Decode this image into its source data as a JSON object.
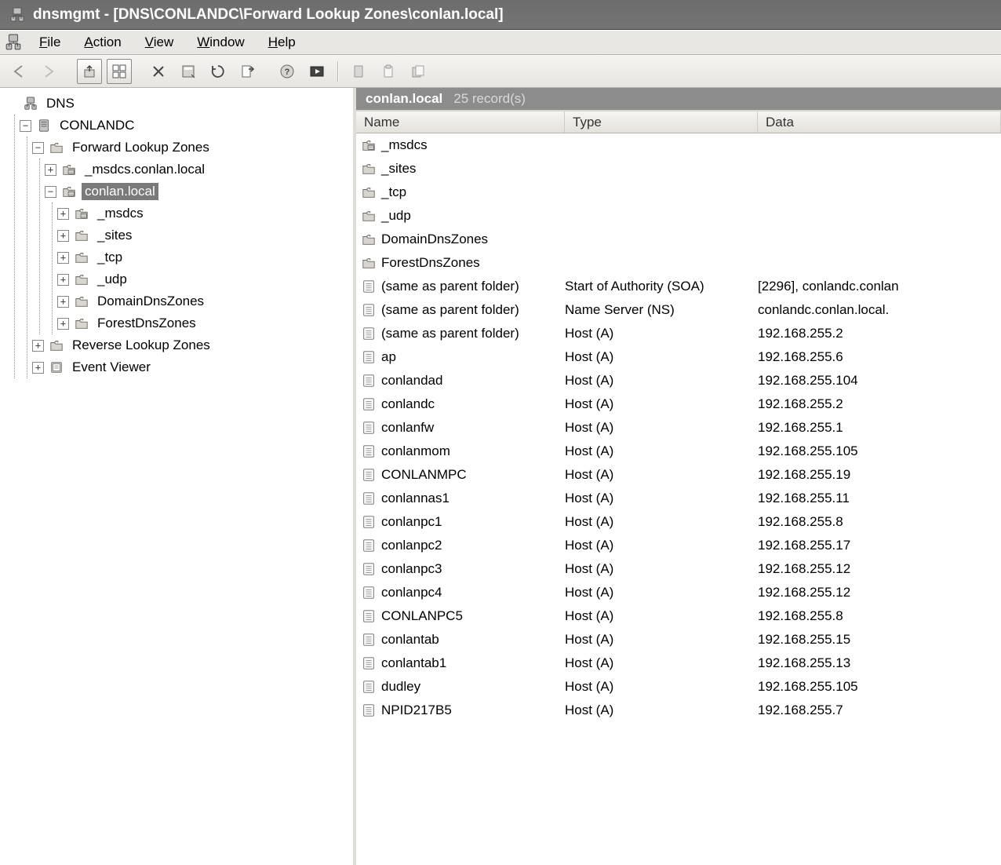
{
  "window": {
    "title": "dnsmgmt - [DNS\\CONLANDC\\Forward Lookup Zones\\conlan.local]"
  },
  "menu": {
    "file": {
      "pre": "",
      "hot": "F",
      "post": "ile"
    },
    "action": {
      "pre": "",
      "hot": "A",
      "post": "ction"
    },
    "view": {
      "pre": "",
      "hot": "V",
      "post": "iew"
    },
    "window": {
      "pre": "",
      "hot": "W",
      "post": "indow"
    },
    "help": {
      "pre": "",
      "hot": "H",
      "post": "elp"
    }
  },
  "tree": {
    "root": "DNS",
    "server": "CONLANDC",
    "flz": "Forward Lookup Zones",
    "msdcs_zone": "_msdcs.conlan.local",
    "zone": "conlan.local",
    "sub": {
      "msdcs": "_msdcs",
      "sites": "_sites",
      "tcp": "_tcp",
      "udp": "_udp",
      "ddz": "DomainDnsZones",
      "fdz": "ForestDnsZones"
    },
    "rlz": "Reverse Lookup Zones",
    "ev": "Event Viewer"
  },
  "zone_header": {
    "name": "conlan.local",
    "count": "25 record(s)"
  },
  "columns": {
    "name": "Name",
    "type": "Type",
    "data": "Data"
  },
  "records": [
    {
      "icon": "zfolder",
      "name": "_msdcs",
      "type": "",
      "data": ""
    },
    {
      "icon": "folder",
      "name": "_sites",
      "type": "",
      "data": ""
    },
    {
      "icon": "folder",
      "name": "_tcp",
      "type": "",
      "data": ""
    },
    {
      "icon": "folder",
      "name": "_udp",
      "type": "",
      "data": ""
    },
    {
      "icon": "folder",
      "name": "DomainDnsZones",
      "type": "",
      "data": ""
    },
    {
      "icon": "folder",
      "name": "ForestDnsZones",
      "type": "",
      "data": ""
    },
    {
      "icon": "rec",
      "name": "(same as parent folder)",
      "type": "Start of Authority (SOA)",
      "data": "[2296], conlandc.conlan"
    },
    {
      "icon": "rec",
      "name": "(same as parent folder)",
      "type": "Name Server (NS)",
      "data": "conlandc.conlan.local."
    },
    {
      "icon": "rec",
      "name": "(same as parent folder)",
      "type": "Host (A)",
      "data": "192.168.255.2"
    },
    {
      "icon": "rec",
      "name": "ap",
      "type": "Host (A)",
      "data": "192.168.255.6"
    },
    {
      "icon": "rec",
      "name": "conlandad",
      "type": "Host (A)",
      "data": "192.168.255.104"
    },
    {
      "icon": "rec",
      "name": "conlandc",
      "type": "Host (A)",
      "data": "192.168.255.2"
    },
    {
      "icon": "rec",
      "name": "conlanfw",
      "type": "Host (A)",
      "data": "192.168.255.1"
    },
    {
      "icon": "rec",
      "name": "conlanmom",
      "type": "Host (A)",
      "data": "192.168.255.105"
    },
    {
      "icon": "rec",
      "name": "CONLANMPC",
      "type": "Host (A)",
      "data": "192.168.255.19"
    },
    {
      "icon": "rec",
      "name": "conlannas1",
      "type": "Host (A)",
      "data": "192.168.255.11"
    },
    {
      "icon": "rec",
      "name": "conlanpc1",
      "type": "Host (A)",
      "data": "192.168.255.8"
    },
    {
      "icon": "rec",
      "name": "conlanpc2",
      "type": "Host (A)",
      "data": "192.168.255.17"
    },
    {
      "icon": "rec",
      "name": "conlanpc3",
      "type": "Host (A)",
      "data": "192.168.255.12"
    },
    {
      "icon": "rec",
      "name": "conlanpc4",
      "type": "Host (A)",
      "data": "192.168.255.12"
    },
    {
      "icon": "rec",
      "name": "CONLANPC5",
      "type": "Host (A)",
      "data": "192.168.255.8"
    },
    {
      "icon": "rec",
      "name": "conlantab",
      "type": "Host (A)",
      "data": "192.168.255.15"
    },
    {
      "icon": "rec",
      "name": "conlantab1",
      "type": "Host (A)",
      "data": "192.168.255.13"
    },
    {
      "icon": "rec",
      "name": "dudley",
      "type": "Host (A)",
      "data": "192.168.255.105"
    },
    {
      "icon": "rec",
      "name": "NPID217B5",
      "type": "Host (A)",
      "data": "192.168.255.7"
    }
  ]
}
